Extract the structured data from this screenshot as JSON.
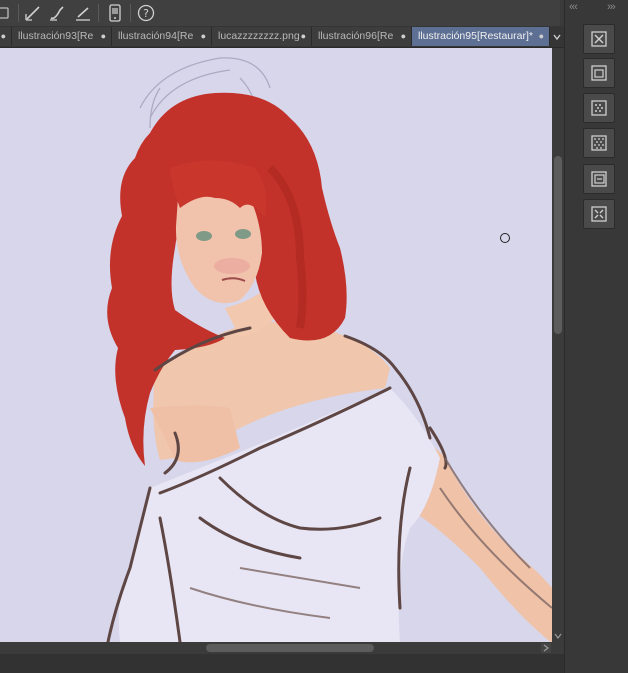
{
  "document_tabs": [
    {
      "label": "llustración93[Re",
      "close": "●",
      "active": false
    },
    {
      "label": "llustración94[Re",
      "close": "●",
      "active": false
    },
    {
      "label": "lucazzzzzzzz.png",
      "close": "●",
      "active": false
    },
    {
      "label": "llustración96[Re",
      "close": "●",
      "active": false
    },
    {
      "label": "llustración95[Restaurar]*",
      "close": "●",
      "active": true
    }
  ],
  "toolbar": {
    "icons": [
      "square-icon",
      "correct-line-icon",
      "smooth-brush-icon",
      "ruler-line-icon",
      "device-icon",
      "help-icon"
    ]
  },
  "side_panel": {
    "collapse_left": "«‹",
    "collapse_right": "›»",
    "icons": [
      "close-canvas-icon",
      "layer-frame-icon",
      "tone-grid-icon",
      "tone-grid-alt-icon",
      "layer-property-icon",
      "transform-layer-icon"
    ]
  },
  "colors": {
    "canvas_bg": "#d7d6ea",
    "active_tab": "#5d6f93",
    "hair": "#c3322a",
    "skin": "#f0c2a8",
    "sketch": "#5e4644"
  }
}
